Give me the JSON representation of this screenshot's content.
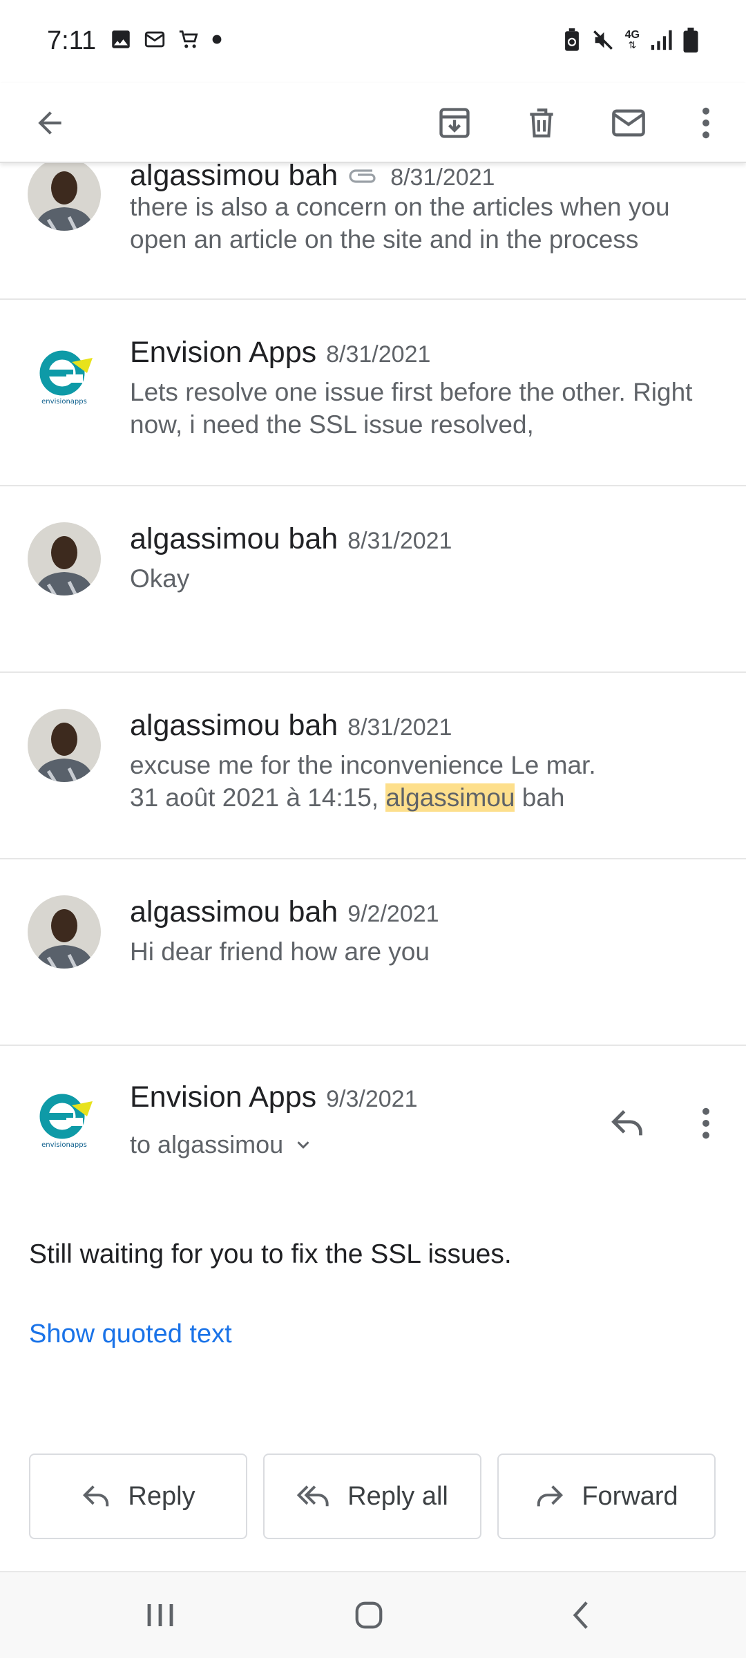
{
  "status_bar": {
    "time": "7:11",
    "network": "4G",
    "left_icons": [
      "image-icon",
      "mail-icon",
      "cart-icon",
      "dot-icon"
    ],
    "right_icons": [
      "battery-saver-icon",
      "mute-icon",
      "4g-icon",
      "signal-icon",
      "battery-icon"
    ]
  },
  "app_bar": {
    "icons": [
      "back-arrow-icon",
      "archive-icon",
      "delete-icon",
      "mark-unread-icon",
      "more-vert-icon"
    ]
  },
  "thread": {
    "messages": [
      {
        "sender": "algassimou bah",
        "date": "8/31/2021",
        "snippet": "there is also a concern on the articles when you open an article on the site and in the process",
        "has_attachment": true,
        "avatar": "person-photo"
      },
      {
        "sender": "Envision Apps",
        "date": "8/31/2021",
        "snippet": "Lets resolve one issue first before the other. Right now, i need the SSL issue resolved,",
        "avatar": "envision-logo"
      },
      {
        "sender": "algassimou bah",
        "date": "8/31/2021",
        "snippet": "Okay",
        "avatar": "person-photo"
      },
      {
        "sender": "algassimou bah",
        "date": "8/31/2021",
        "snippet_line1": "excuse me for the inconvenience Le mar.",
        "snippet_line2_before": "31 août 2021 à 14:15, ",
        "snippet_highlight": "algassimou",
        "snippet_line2_after": " bah",
        "avatar": "person-photo"
      },
      {
        "sender": "algassimou bah",
        "date": "9/2/2021",
        "snippet": "Hi dear friend how are you",
        "avatar": "person-photo"
      }
    ]
  },
  "open_message": {
    "sender": "Envision Apps",
    "date": "9/3/2021",
    "to": "to algassimou",
    "body": "Still waiting for you to fix the SSL issues.",
    "show_quoted": "Show quoted text",
    "logo_text": "envisionapps"
  },
  "actions": {
    "reply": "Reply",
    "reply_all": "Reply all",
    "forward": "Forward"
  },
  "colors": {
    "link": "#1a73e8",
    "highlight": "#fddf8c",
    "logo_teal": "#0e9aa7",
    "logo_yellow": "#e8e21c"
  }
}
